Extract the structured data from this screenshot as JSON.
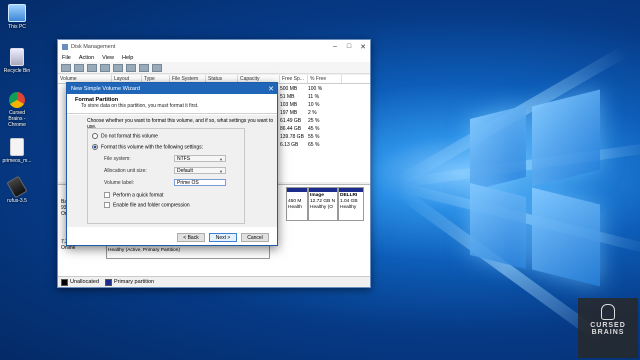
{
  "desktop": {
    "icons": [
      {
        "label": "This PC",
        "icon": "computer-icon"
      },
      {
        "label": "Recycle Bin",
        "icon": "recycle-bin-icon"
      },
      {
        "label": "Cursed Brains - Chrome",
        "icon": "chrome-icon"
      },
      {
        "label": "primeos_m...",
        "icon": "file-icon"
      },
      {
        "label": "rufus-3.5",
        "icon": "usb-drive-icon"
      }
    ],
    "watermark": {
      "line1": "CURSED",
      "line2": "BRAINS"
    }
  },
  "window": {
    "title": "Disk Management",
    "menu": [
      "File",
      "Action",
      "View",
      "Help"
    ],
    "columns": [
      "Volume",
      "Layout",
      "Type",
      "File System",
      "Status",
      "Capacity",
      "Free Sp...",
      "% Free"
    ],
    "volumes": [
      {
        "free": "500 MB",
        "pct": "100 %"
      },
      {
        "free": "51 MB",
        "pct": "11 %"
      },
      {
        "free": "103 MB",
        "pct": "10 %"
      },
      {
        "free": "197 MB",
        "pct": "2 %"
      },
      {
        "free": "61.49 GB",
        "pct": "25 %"
      },
      {
        "free": "86.44 GB",
        "pct": "45 %"
      },
      {
        "free": "139.78 GB",
        "pct": "55 %"
      },
      {
        "free": "6.13 GB",
        "pct": "65 %"
      }
    ],
    "disk_partitions": [
      {
        "name": "",
        "size": "450 M",
        "status": "Health"
      },
      {
        "name": "Image",
        "size": "12.72 GB N",
        "status": "Healthy (O"
      },
      {
        "name": "DELLRI",
        "size": "1.04 GB",
        "status": "Healthy"
      }
    ],
    "disk_labels": [
      "Ba",
      "93",
      "On"
    ],
    "removable": {
      "size": "7.21 GB",
      "status": "Online",
      "part_size": "7.21 GB FAT32",
      "part_status": "Healthy (Active, Primary Partition)"
    },
    "legend": [
      "Unallocated",
      "Primary partition"
    ]
  },
  "wizard": {
    "title": "New Simple Volume Wizard",
    "heading": "Format Partition",
    "subheading": "To store data on this partition, you must format it first.",
    "prompt": "Choose whether you want to format this volume, and if so, what settings you want to use.",
    "opt_no_format": "Do not format this volume",
    "opt_format": "Format this volume with the following settings:",
    "fs_label": "File system:",
    "fs_value": "NTFS",
    "alloc_label": "Allocation unit size:",
    "alloc_value": "Default",
    "vol_label": "Volume label:",
    "vol_value": "Prime OS",
    "quick_format": "Perform a quick format",
    "compression": "Enable file and folder compression",
    "back": "< Back",
    "next": "Next >",
    "cancel": "Cancel"
  }
}
